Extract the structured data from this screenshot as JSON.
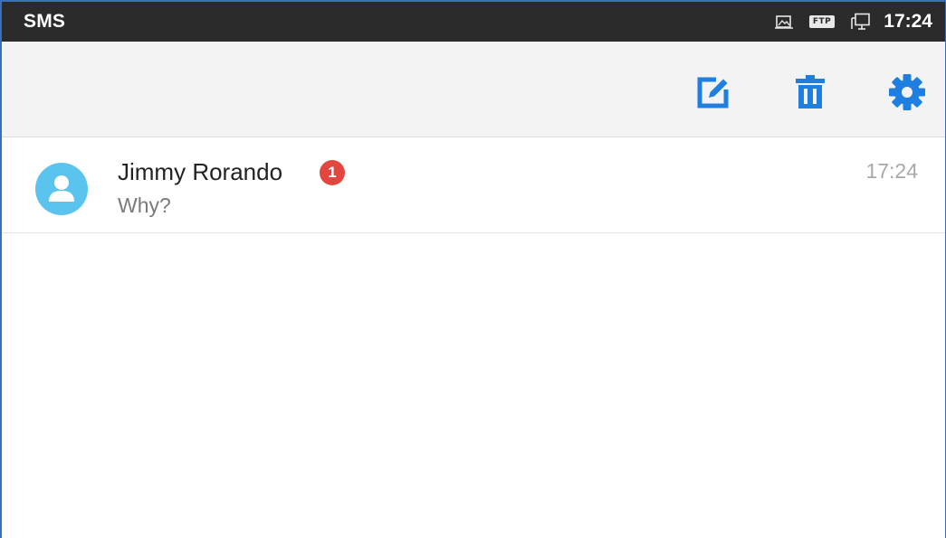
{
  "status_bar": {
    "app_name": "SMS",
    "icons": [
      "screenshot-icon",
      "ftp-icon",
      "network-icon"
    ],
    "ftp_label": "FTP",
    "time": "17:24"
  },
  "toolbar": {
    "actions": [
      {
        "name": "compose",
        "icon": "compose-icon"
      },
      {
        "name": "delete",
        "icon": "trash-icon"
      },
      {
        "name": "settings",
        "icon": "gear-icon"
      }
    ],
    "accent_color": "#1e7fe0"
  },
  "conversations": [
    {
      "contact": "Jimmy Rorando",
      "unread_count": "1",
      "snippet": "Why?",
      "time": "17:24",
      "avatar_icon": "person-icon",
      "avatar_color": "#5bc4ee",
      "badge_color": "#e2463f"
    }
  ]
}
